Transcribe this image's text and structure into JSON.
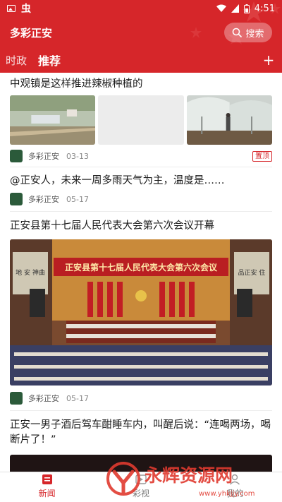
{
  "status_bar": {
    "time": "4:51",
    "left_glyph": "虫"
  },
  "header": {
    "title": "多彩正安",
    "search_label": "搜索"
  },
  "tabs": [
    {
      "label": "时政",
      "active": false
    },
    {
      "label": "推荐",
      "active": true
    }
  ],
  "tab_add_label": "+",
  "feed": [
    {
      "title": "中观镇是这样推进辣椒种植的",
      "source": "多彩正安",
      "date": "03-13",
      "badge": "置顶"
    },
    {
      "title": "@正安人，未来一周多雨天气为主，温度是……",
      "source": "多彩正安",
      "date": "05-17"
    },
    {
      "title": "正安县第十七届人民代表大会第六次会议开幕",
      "source": "多彩正安",
      "date": "05-17",
      "image_banner": "正安县第十七届人民代表大会第六次会议",
      "image_side_left": "地 安 神曲",
      "image_side_right": "品正安 住"
    },
    {
      "title": "正安一男子酒后驾车酣睡车内，叫醒后说：“连喝两场，喝断片了！”"
    }
  ],
  "bottom_nav": [
    {
      "label": "新闻",
      "active": true
    },
    {
      "label": "彩视",
      "active": false
    },
    {
      "label": "我的",
      "active": false
    }
  ],
  "watermark": {
    "text": "永辉资源网",
    "url": "www.yhkjjy.com"
  },
  "colors": {
    "brand_red": "#d6262a"
  }
}
